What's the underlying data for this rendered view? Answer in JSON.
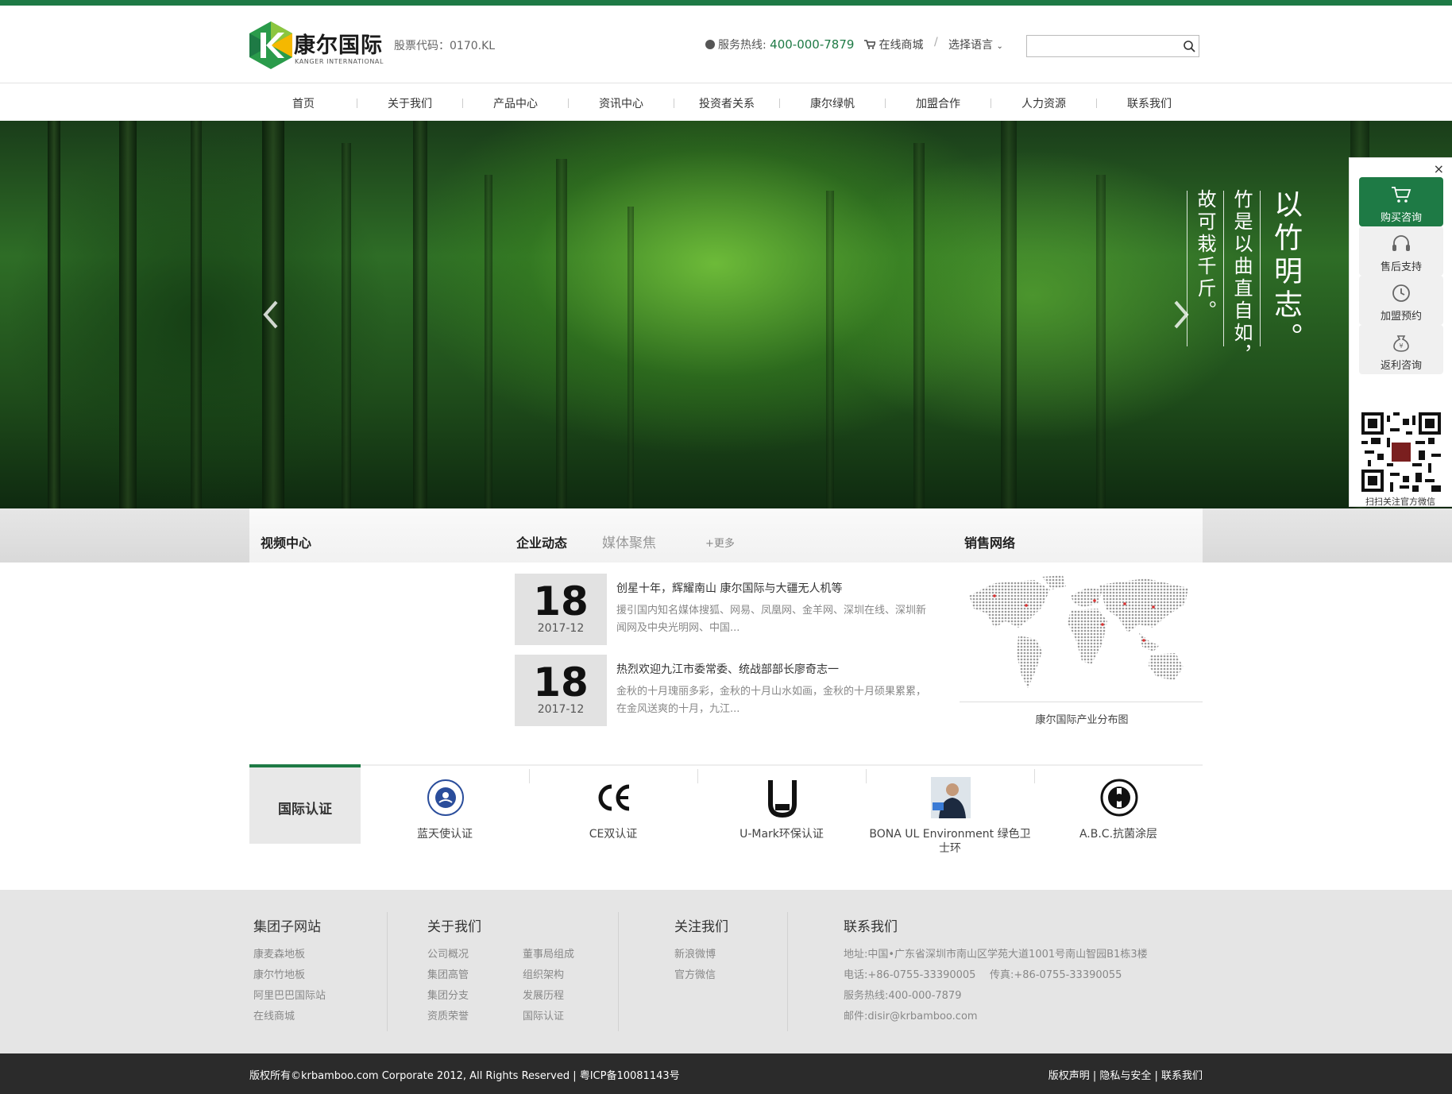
{
  "header": {
    "logo_cn": "康尔国际",
    "logo_en": "KANGER INTERNATIONAL",
    "stock": "股票代码：0170.KL",
    "hotline_label": "服务热线:",
    "hotline_number": "400-000-7879",
    "mall": "在线商城",
    "separator": "/",
    "language": "选择语言",
    "search_placeholder": ""
  },
  "nav": [
    "首页",
    "关于我们",
    "产品中心",
    "资讯中心",
    "投资者关系",
    "康尔绿帆",
    "加盟合作",
    "人力资源",
    "联系我们"
  ],
  "banner": {
    "poem_line1": "以竹明志。",
    "poem_line2": "竹是以曲直自如，",
    "poem_line3": "故可栽千斤。"
  },
  "sidebar": {
    "close": "×",
    "buttons": [
      {
        "label": "购买咨询",
        "icon": "cart-icon"
      },
      {
        "label": "售后支持",
        "icon": "headset-icon"
      },
      {
        "label": "加盟预约",
        "icon": "clock-icon"
      },
      {
        "label": "返利咨询",
        "icon": "moneybag-icon"
      }
    ],
    "qr_caption": "扫扫关注官方微信"
  },
  "sections": {
    "video_title": "视频中心",
    "more": "+更多",
    "news_tab_active": "企业动态",
    "news_tab_other": "媒体聚焦",
    "sales_title": "销售网络",
    "map_caption": "康尔国际产业分布图"
  },
  "news": [
    {
      "day": "18",
      "ym": "2017-12",
      "title": "创星十年，辉耀南山 康尔国际与大疆无人机等",
      "desc": "援引国内知名媒体搜狐、网易、凤凰网、金羊网、深圳在线、深圳新闻网及中央光明网、中国..."
    },
    {
      "day": "18",
      "ym": "2017-12",
      "title": "热烈欢迎九江市委常委、统战部部长廖奇志一",
      "desc": "金秋的十月瑰丽多彩，金秋的十月山水如画，金秋的十月硕果累累，在金风送爽的十月，九江..."
    }
  ],
  "cert": {
    "tab": "国际认证",
    "items": [
      "蓝天使认证",
      "CE双认证",
      "U-Mark环保认证",
      "BONA UL Environment 绿色卫士环",
      "A.B.C.抗菌涂层"
    ]
  },
  "footer": {
    "col1_title": "集团子网站",
    "col1_links": [
      "康麦森地板",
      "康尔竹地板",
      "阿里巴巴国际站",
      "在线商城"
    ],
    "col2_title": "关于我们",
    "col2_links_a": [
      "公司概况",
      "集团高管",
      "集团分支",
      "资质荣誉"
    ],
    "col2_links_b": [
      "董事局组成",
      "组织架构",
      "发展历程",
      "国际认证"
    ],
    "col3_title": "关注我们",
    "col3_links": [
      "新浪微博",
      "官方微信"
    ],
    "col4_title": "联系我们",
    "address": "地址:中国•广东省深圳市南山区学苑大道1001号南山智园B1栋3楼",
    "phone": "电话:+86-0755-33390005",
    "fax": "传真:+86-0755-33390055",
    "service": "服务热线:400-000-7879",
    "email": "邮件:disir@krbamboo.com"
  },
  "bottom": {
    "copyright": "版权所有©krbamboo.com Corporate 2012, All Rights Reserved | 粤ICP备10081143号",
    "links": "版权声明 | 隐私与安全 | 联系我们"
  },
  "colors": {
    "brand_green": "#1e7a45",
    "footer_bg": "#e5e5e5",
    "bottom_bg": "#2b2b2b"
  }
}
